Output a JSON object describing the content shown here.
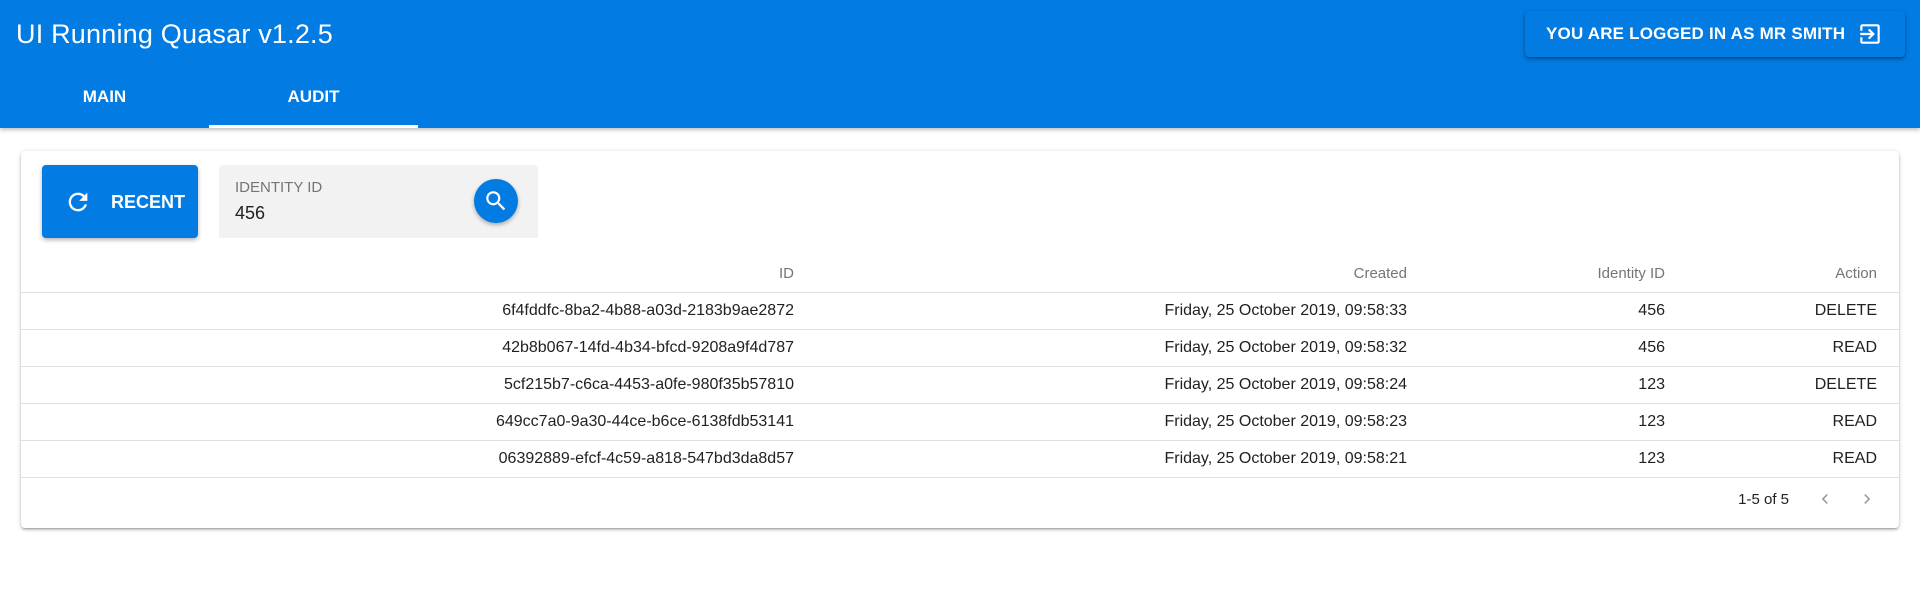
{
  "header": {
    "title": "UI Running Quasar v1.2.5",
    "user_button_label": "YOU ARE LOGGED IN AS MR SMITH",
    "user_button_icon": "logout-icon",
    "tabs": [
      {
        "label": "MAIN",
        "active": false
      },
      {
        "label": "AUDIT",
        "active": true
      }
    ],
    "brand_color": "#027be3"
  },
  "toolbar": {
    "recent_label": "RECENT",
    "recent_icon": "refresh-icon",
    "identity_field": {
      "label": "IDENTITY ID",
      "value": "456"
    },
    "search_icon": "search-icon"
  },
  "table": {
    "columns": [
      "ID",
      "Created",
      "Identity ID",
      "Action"
    ],
    "rows": [
      {
        "id": "6f4fddfc-8ba2-4b88-a03d-2183b9ae2872",
        "created": "Friday, 25 October 2019, 09:58:33",
        "identity_id": "456",
        "action": "DELETE"
      },
      {
        "id": "42b8b067-14fd-4b34-bfcd-9208a9f4d787",
        "created": "Friday, 25 October 2019, 09:58:32",
        "identity_id": "456",
        "action": "READ"
      },
      {
        "id": "5cf215b7-c6ca-4453-a0fe-980f35b57810",
        "created": "Friday, 25 October 2019, 09:58:24",
        "identity_id": "123",
        "action": "DELETE"
      },
      {
        "id": "649cc7a0-9a30-44ce-b6ce-6138fdb53141",
        "created": "Friday, 25 October 2019, 09:58:23",
        "identity_id": "123",
        "action": "READ"
      },
      {
        "id": "06392889-efcf-4c59-a818-547bd3da8d57",
        "created": "Friday, 25 October 2019, 09:58:21",
        "identity_id": "123",
        "action": "READ"
      }
    ]
  },
  "pagination": {
    "info": "1-5 of 5",
    "prev_icon": "chevron-left-icon",
    "next_icon": "chevron-right-icon"
  }
}
